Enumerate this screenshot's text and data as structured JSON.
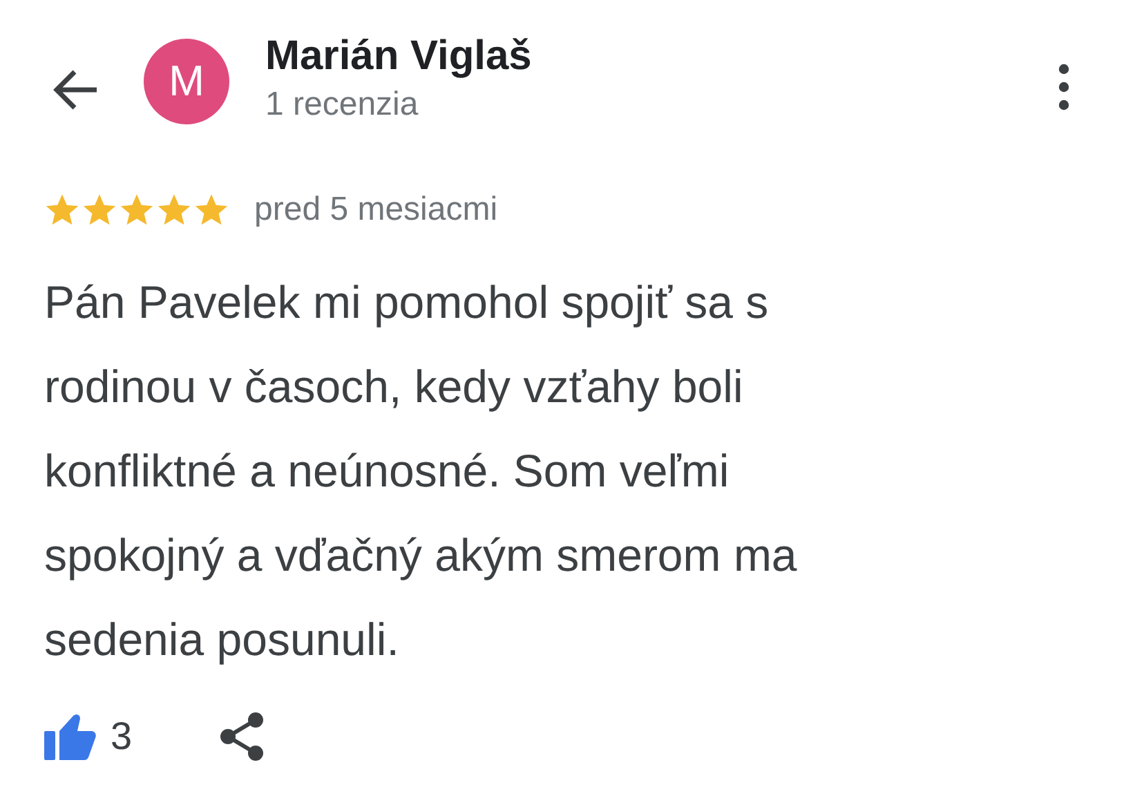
{
  "reviewer": {
    "initial": "M",
    "name": "Marián Viglaš",
    "review_count": "1 recenzia"
  },
  "review": {
    "stars": 5,
    "time": "pred 5 mesiacmi",
    "text": "Pán Pavelek mi pomohol spojiť sa s\nrodinou v časoch, kedy vzťahy boli\nkonfliktné a neúnosné. Som veľmi\nspokojný a vďačný akým smerom ma\nsedenia posunuli."
  },
  "actions": {
    "likes": "3",
    "liked": true
  }
}
